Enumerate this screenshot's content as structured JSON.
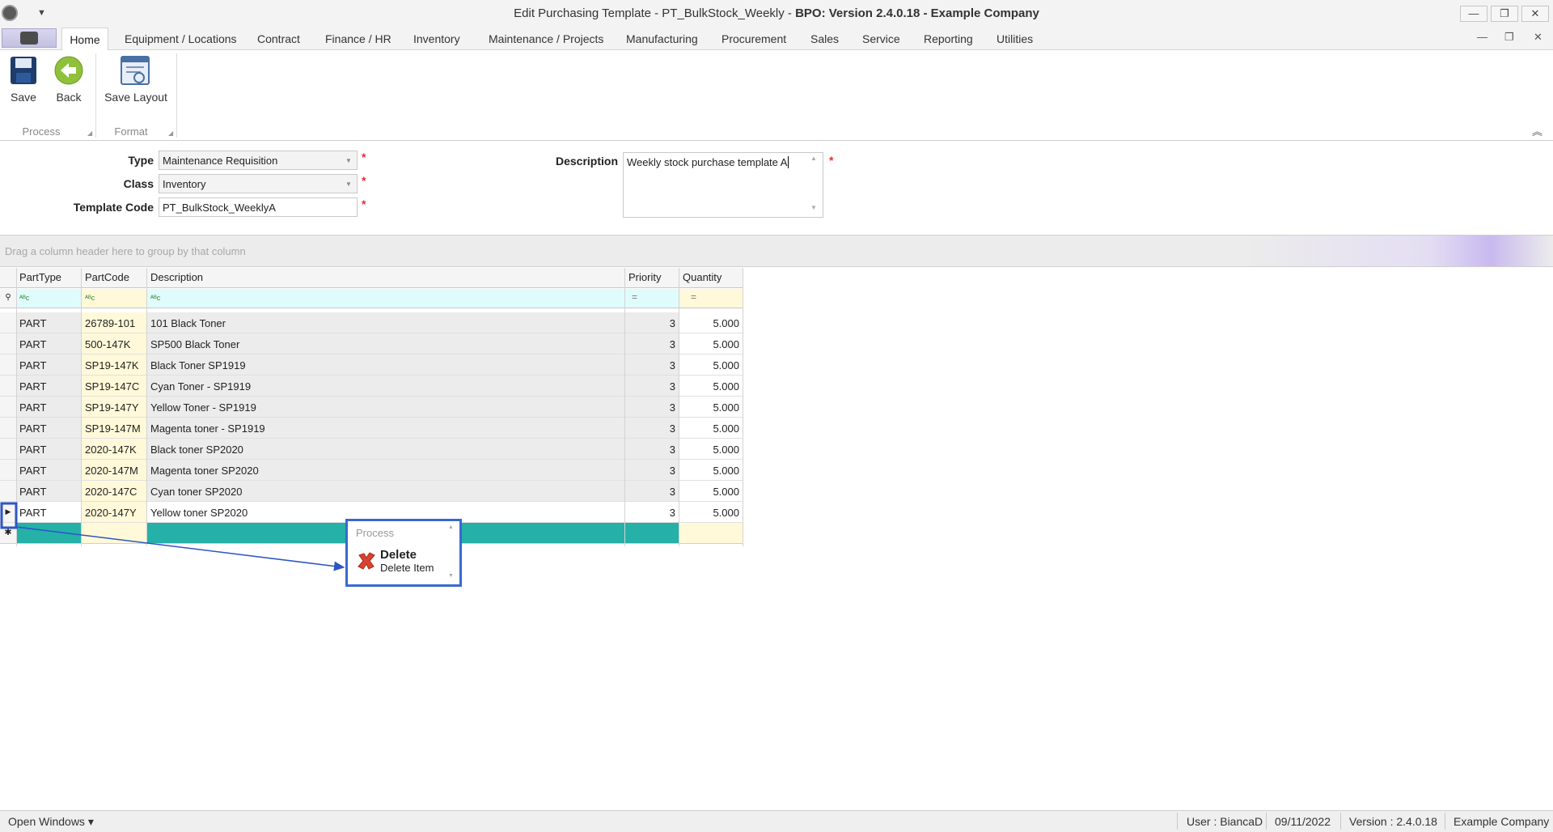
{
  "window": {
    "title_prefix": "Edit Purchasing Template - PT_BulkStock_Weekly - ",
    "title_bold": "BPO: Version 2.4.0.18 - Example Company",
    "min_icon": "—",
    "restore_icon": "❐",
    "close_icon": "✕"
  },
  "tabs": {
    "home": "Home",
    "items": [
      "Equipment / Locations",
      "Contract",
      "Finance / HR",
      "Inventory",
      "Maintenance / Projects",
      "Manufacturing",
      "Procurement",
      "Sales",
      "Service",
      "Reporting",
      "Utilities"
    ]
  },
  "ribbon": {
    "save": "Save",
    "back": "Back",
    "save_layout": "Save Layout",
    "group_process": "Process",
    "group_format": "Format"
  },
  "form": {
    "type_label": "Type",
    "type_value": "Maintenance Requisition",
    "class_label": "Class",
    "class_value": "Inventory",
    "code_label": "Template Code",
    "code_value": "PT_BulkStock_WeeklyA",
    "desc_label": "Description",
    "desc_value": "Weekly stock purchase template A",
    "required_mark": "*"
  },
  "grid": {
    "group_hint": "Drag a column header here to group by that column",
    "columns": [
      "PartType",
      "PartCode",
      "Description",
      "Priority",
      "Quantity"
    ],
    "filter_text": "ᴬᴮc",
    "filter_eq": "=",
    "rows": [
      [
        "PART",
        "26789-101",
        "101 Black Toner",
        "3",
        "5.000"
      ],
      [
        "PART",
        "500-147K",
        "SP500 Black Toner",
        "3",
        "5.000"
      ],
      [
        "PART",
        "SP19-147K",
        "Black Toner SP1919",
        "3",
        "5.000"
      ],
      [
        "PART",
        "SP19-147C",
        "Cyan Toner - SP1919",
        "3",
        "5.000"
      ],
      [
        "PART",
        "SP19-147Y",
        "Yellow Toner - SP1919",
        "3",
        "5.000"
      ],
      [
        "PART",
        "SP19-147M",
        "Magenta toner - SP1919",
        "3",
        "5.000"
      ],
      [
        "PART",
        "2020-147K",
        "Black toner SP2020",
        "3",
        "5.000"
      ],
      [
        "PART",
        "2020-147M",
        "Magenta toner SP2020",
        "3",
        "5.000"
      ],
      [
        "PART",
        "2020-147C",
        "Cyan toner SP2020",
        "3",
        "5.000"
      ],
      [
        "PART",
        "2020-147Y",
        "Yellow toner SP2020",
        "3",
        "5.000"
      ]
    ],
    "selected_row_index": 9,
    "new_row_color": "#25b0a8"
  },
  "popup": {
    "title": "Process",
    "delete": "Delete",
    "delete_sub": "Delete Item",
    "icon": "delete-icon"
  },
  "status": {
    "open_windows": "Open Windows ▾",
    "user": "User : BiancaD",
    "date": "09/11/2022",
    "version": "Version : 2.4.0.18",
    "company": "Example Company"
  },
  "colors": {
    "accent": "#3b68d1",
    "required": "#e03030",
    "code_bg": "#fff9d9",
    "new_row": "#25b0a8"
  }
}
